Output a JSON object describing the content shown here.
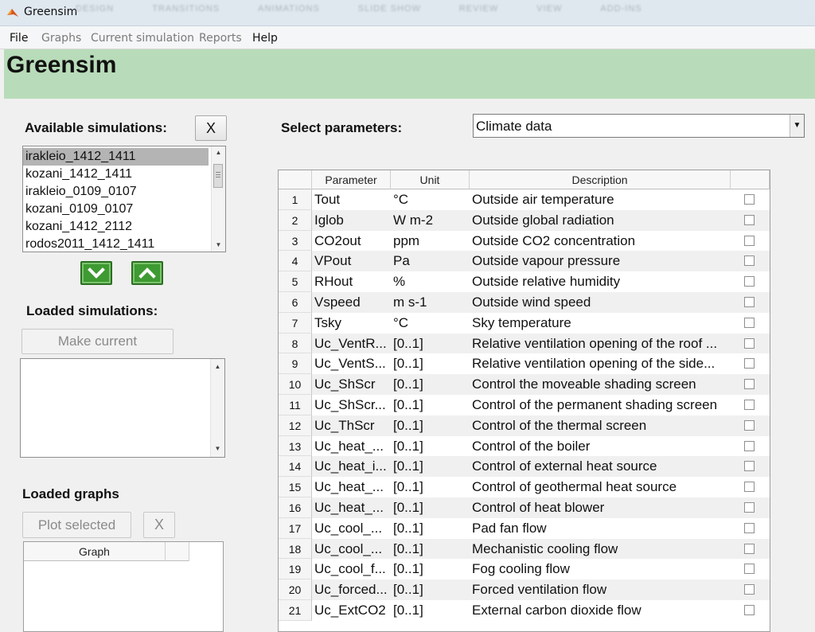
{
  "window": {
    "title": "Greensim"
  },
  "ghost_ribbon": [
    "DESIGN",
    "TRANSITIONS",
    "ANIMATIONS",
    "SLIDE SHOW",
    "REVIEW",
    "VIEW",
    "ADD-INS"
  ],
  "menu": [
    {
      "label": "File",
      "enabled": true
    },
    {
      "label": "Graphs",
      "enabled": false
    },
    {
      "label": "Current simulation",
      "enabled": false
    },
    {
      "label": "Reports",
      "enabled": false
    },
    {
      "label": "Help",
      "enabled": true
    }
  ],
  "header": {
    "title": "Greensim"
  },
  "available": {
    "label": "Available simulations:",
    "clear_label": "X",
    "items": [
      "irakleio_1412_1411",
      "kozani_1412_1411",
      "irakleio_0109_0107",
      "kozani_0109_0107",
      "kozani_1412_2112",
      "rodos2011_1412_1411"
    ],
    "selected_index": 0
  },
  "loaded": {
    "label": "Loaded simulations:",
    "make_current_label": "Make current",
    "items": []
  },
  "graphs": {
    "label": "Loaded graphs",
    "plot_label": "Plot selected",
    "remove_label": "X",
    "columns": [
      "Graph",
      ""
    ]
  },
  "parameters": {
    "label": "Select parameters:",
    "dropdown_value": "Climate data",
    "columns": [
      "Parameter",
      "Unit",
      "Description",
      ""
    ],
    "rows": [
      {
        "num": "1",
        "param": "Tout",
        "unit": "°C",
        "desc": "Outside air temperature",
        "checked": false
      },
      {
        "num": "2",
        "param": "Iglob",
        "unit": "W m-2",
        "desc": "Outside global radiation",
        "checked": false
      },
      {
        "num": "3",
        "param": "CO2out",
        "unit": "ppm",
        "desc": "Outside CO2 concentration",
        "checked": false
      },
      {
        "num": "4",
        "param": "VPout",
        "unit": "Pa",
        "desc": "Outside vapour pressure",
        "checked": false
      },
      {
        "num": "5",
        "param": "RHout",
        "unit": "%",
        "desc": "Outside relative humidity",
        "checked": false
      },
      {
        "num": "6",
        "param": "Vspeed",
        "unit": "m s-1",
        "desc": "Outside wind speed",
        "checked": false
      },
      {
        "num": "7",
        "param": "Tsky",
        "unit": "°C",
        "desc": "Sky temperature",
        "checked": false
      },
      {
        "num": "8",
        "param": "Uc_VentR...",
        "unit": "[0..1]",
        "desc": "Relative ventilation opening of the roof ...",
        "checked": false
      },
      {
        "num": "9",
        "param": "Uc_VentS...",
        "unit": "[0..1]",
        "desc": "Relative ventilation opening of the side...",
        "checked": false
      },
      {
        "num": "10",
        "param": "Uc_ShScr",
        "unit": "[0..1]",
        "desc": "Control the moveable shading screen",
        "checked": false
      },
      {
        "num": "11",
        "param": "Uc_ShScr...",
        "unit": "[0..1]",
        "desc": "Control of the permanent shading screen",
        "checked": false
      },
      {
        "num": "12",
        "param": "Uc_ThScr",
        "unit": "[0..1]",
        "desc": "Control of the thermal screen",
        "checked": false
      },
      {
        "num": "13",
        "param": "Uc_heat_...",
        "unit": "[0..1]",
        "desc": "Control of the boiler",
        "checked": false
      },
      {
        "num": "14",
        "param": "Uc_heat_i...",
        "unit": "[0..1]",
        "desc": "Control of external heat source",
        "checked": false
      },
      {
        "num": "15",
        "param": "Uc_heat_...",
        "unit": "[0..1]",
        "desc": "Control of geothermal heat source",
        "checked": false
      },
      {
        "num": "16",
        "param": "Uc_heat_...",
        "unit": "[0..1]",
        "desc": "Control of heat blower",
        "checked": false
      },
      {
        "num": "17",
        "param": "Uc_cool_...",
        "unit": "[0..1]",
        "desc": "Pad fan flow",
        "checked": false
      },
      {
        "num": "18",
        "param": "Uc_cool_...",
        "unit": "[0..1]",
        "desc": "Mechanistic cooling flow",
        "checked": false
      },
      {
        "num": "19",
        "param": "Uc_cool_f...",
        "unit": "[0..1]",
        "desc": "Fog cooling flow",
        "checked": false
      },
      {
        "num": "20",
        "param": "Uc_forced...",
        "unit": "[0..1]",
        "desc": "Forced ventilation flow",
        "checked": false
      },
      {
        "num": "21",
        "param": "Uc_ExtCO2",
        "unit": "[0..1]",
        "desc": "External carbon dioxide flow",
        "checked": false
      }
    ]
  },
  "colors": {
    "header_bg": "#b8dcb9",
    "move_button": "#3e9a32",
    "selection": "#b4b4b4"
  },
  "icons": {
    "app": "matlab-logo-icon",
    "move_down": "chevron-down-icon",
    "move_up": "chevron-up-icon"
  }
}
